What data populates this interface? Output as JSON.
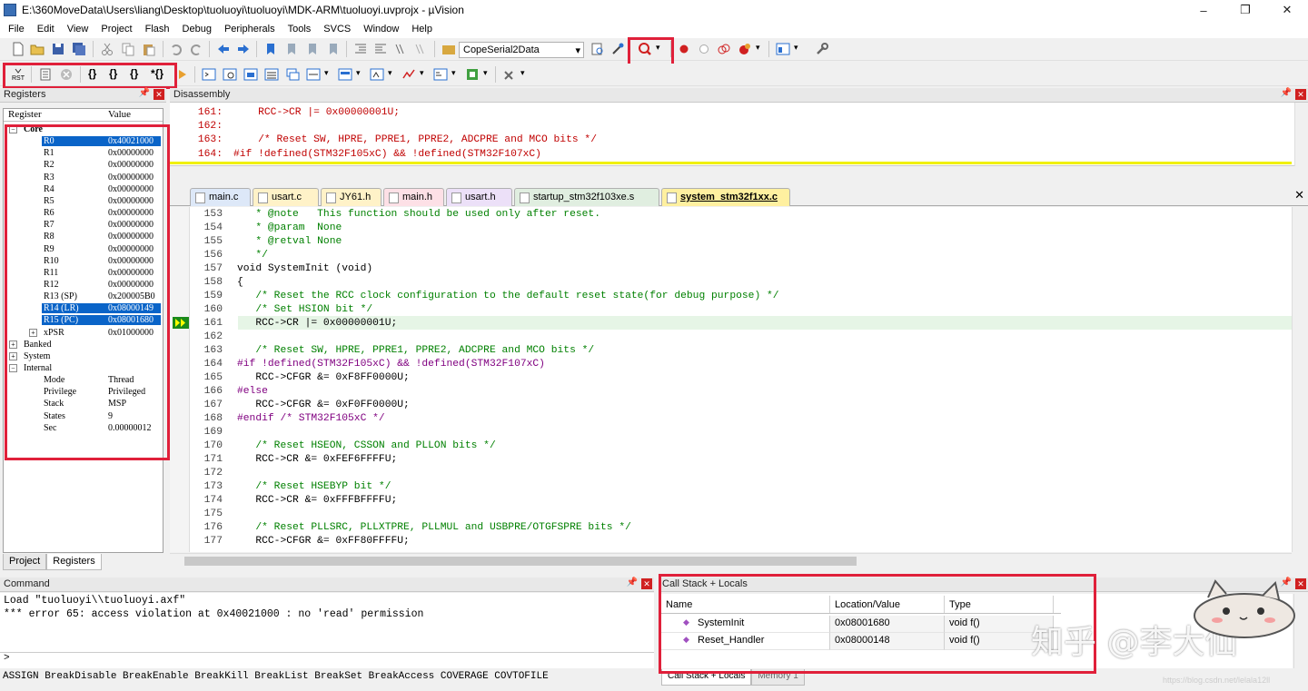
{
  "window": {
    "title": "E:\\360MoveData\\Users\\liang\\Desktop\\tuoluoyi\\tuoluoyi\\MDK-ARM\\tuoluoyi.uvprojx - µVision",
    "min": "–",
    "max": "❐",
    "close": "✕"
  },
  "menu": [
    "File",
    "Edit",
    "View",
    "Project",
    "Flash",
    "Debug",
    "Peripherals",
    "Tools",
    "SVCS",
    "Window",
    "Help"
  ],
  "toolbar": {
    "target_combo": "CopeSerial2Data"
  },
  "registers": {
    "title": "Registers",
    "col_register": "Register",
    "col_value": "Value",
    "rows": [
      {
        "name": "Core",
        "value": "",
        "indent": 1,
        "bold": true,
        "expand": "−"
      },
      {
        "name": "R0",
        "value": "0x40021000",
        "indent": 3,
        "sel": true
      },
      {
        "name": "R1",
        "value": "0x00000000",
        "indent": 3
      },
      {
        "name": "R2",
        "value": "0x00000000",
        "indent": 3
      },
      {
        "name": "R3",
        "value": "0x00000000",
        "indent": 3
      },
      {
        "name": "R4",
        "value": "0x00000000",
        "indent": 3
      },
      {
        "name": "R5",
        "value": "0x00000000",
        "indent": 3
      },
      {
        "name": "R6",
        "value": "0x00000000",
        "indent": 3
      },
      {
        "name": "R7",
        "value": "0x00000000",
        "indent": 3
      },
      {
        "name": "R8",
        "value": "0x00000000",
        "indent": 3
      },
      {
        "name": "R9",
        "value": "0x00000000",
        "indent": 3
      },
      {
        "name": "R10",
        "value": "0x00000000",
        "indent": 3
      },
      {
        "name": "R11",
        "value": "0x00000000",
        "indent": 3
      },
      {
        "name": "R12",
        "value": "0x00000000",
        "indent": 3
      },
      {
        "name": "R13 (SP)",
        "value": "0x200005B0",
        "indent": 3
      },
      {
        "name": "R14 (LR)",
        "value": "0x08000149",
        "indent": 3,
        "sel": true
      },
      {
        "name": "R15 (PC)",
        "value": "0x08001680",
        "indent": 3,
        "sel": true
      },
      {
        "name": "xPSR",
        "value": "0x01000000",
        "indent": 3,
        "expand": "+"
      },
      {
        "name": "Banked",
        "value": "",
        "indent": 1,
        "expand": "+"
      },
      {
        "name": "System",
        "value": "",
        "indent": 1,
        "expand": "+"
      },
      {
        "name": "Internal",
        "value": "",
        "indent": 1,
        "expand": "−"
      },
      {
        "name": "Mode",
        "value": "Thread",
        "indent": 3
      },
      {
        "name": "Privilege",
        "value": "Privileged",
        "indent": 3
      },
      {
        "name": "Stack",
        "value": "MSP",
        "indent": 3
      },
      {
        "name": "States",
        "value": "9",
        "indent": 3
      },
      {
        "name": "Sec",
        "value": "0.00000012",
        "indent": 3
      }
    ],
    "tab_project": "Project",
    "tab_registers": "Registers"
  },
  "disassembly": {
    "title": "Disassembly",
    "lines": [
      {
        "n": "161:",
        "t": "    RCC->CR |= 0x00000001U;"
      },
      {
        "n": "162:",
        "t": ""
      },
      {
        "n": "163:",
        "t": "    /* Reset SW, HPRE, PPRE1, PPRE2, ADCPRE and MCO bits */"
      },
      {
        "n": "164:",
        "t": "#if !defined(STM32F105xC) && !defined(STM32F107xC)"
      }
    ]
  },
  "file_tabs": [
    "main.c",
    "usart.c",
    "JY61.h",
    "main.h",
    "usart.h",
    "startup_stm32f103xe.s",
    "system_stm32f1xx.c"
  ],
  "editor": {
    "lines": [
      {
        "n": "153",
        "t": "   * @note   This function should be used only after reset.",
        "c": "cm"
      },
      {
        "n": "154",
        "t": "   * @param  None",
        "c": "cm"
      },
      {
        "n": "155",
        "t": "   * @retval None",
        "c": "cm"
      },
      {
        "n": "156",
        "t": "   */",
        "c": "cm"
      },
      {
        "n": "157",
        "t": "void SystemInit (void)",
        "c": ""
      },
      {
        "n": "158",
        "t": "{",
        "c": ""
      },
      {
        "n": "159",
        "t": "   /* Reset the RCC clock configuration to the default reset state(for debug purpose) */",
        "c": "cm"
      },
      {
        "n": "160",
        "t": "   /* Set HSION bit */",
        "c": "cm"
      },
      {
        "n": "161",
        "t": "   RCC->CR |= 0x00000001U;",
        "c": ""
      },
      {
        "n": "162",
        "t": "",
        "c": ""
      },
      {
        "n": "163",
        "t": "   /* Reset SW, HPRE, PPRE1, PPRE2, ADCPRE and MCO bits */",
        "c": "cm"
      },
      {
        "n": "164",
        "t": "#if !defined(STM32F105xC) && !defined(STM32F107xC)",
        "c": "pp"
      },
      {
        "n": "165",
        "t": "   RCC->CFGR &= 0xF8FF0000U;",
        "c": ""
      },
      {
        "n": "166",
        "t": "#else",
        "c": "pp"
      },
      {
        "n": "167",
        "t": "   RCC->CFGR &= 0xF0FF0000U;",
        "c": ""
      },
      {
        "n": "168",
        "t": "#endif /* STM32F105xC */",
        "c": "pp"
      },
      {
        "n": "169",
        "t": "",
        "c": ""
      },
      {
        "n": "170",
        "t": "   /* Reset HSEON, CSSON and PLLON bits */",
        "c": "cm"
      },
      {
        "n": "171",
        "t": "   RCC->CR &= 0xFEF6FFFFU;",
        "c": ""
      },
      {
        "n": "172",
        "t": "",
        "c": ""
      },
      {
        "n": "173",
        "t": "   /* Reset HSEBYP bit */",
        "c": "cm"
      },
      {
        "n": "174",
        "t": "   RCC->CR &= 0xFFFBFFFFU;",
        "c": ""
      },
      {
        "n": "175",
        "t": "",
        "c": ""
      },
      {
        "n": "176",
        "t": "   /* Reset PLLSRC, PLLXTPRE, PLLMUL and USBPRE/OTGFSPRE bits */",
        "c": "cm"
      },
      {
        "n": "177",
        "t": "   RCC->CFGR &= 0xFF80FFFFU;",
        "c": ""
      }
    ]
  },
  "command": {
    "title": "Command",
    "lines": [
      "Load \"tuoluoyi\\\\tuoluoyi.axf\"",
      "*** error 65: access violation at 0x40021000 : no 'read' permission"
    ],
    "prompt": ">",
    "hints": "ASSIGN BreakDisable BreakEnable BreakKill BreakList BreakSet BreakAccess COVERAGE COVTOFILE"
  },
  "callstack": {
    "title": "Call Stack + Locals",
    "col_name": "Name",
    "col_loc": "Location/Value",
    "col_type": "Type",
    "rows": [
      {
        "name": "SystemInit",
        "loc": "0x08001680",
        "type": "void f()"
      },
      {
        "name": "Reset_Handler",
        "loc": "0x08000148",
        "type": "void f()"
      }
    ],
    "tab_csl": "Call Stack + Locals",
    "tab_mem": "Memory 1"
  },
  "watermark": {
    "text": "知乎 @李大仙",
    "url": "https://blog.csdn.net/lelala12ll"
  },
  "colors": {
    "selection": "#0a64c8",
    "highlight_box": "#e0203a",
    "exec_line": "#e6f5e6"
  }
}
